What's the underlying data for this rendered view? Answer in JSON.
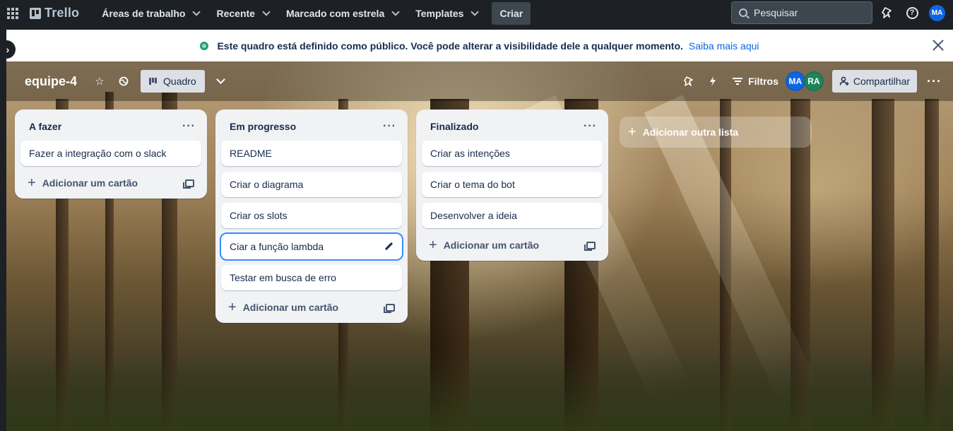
{
  "nav": {
    "logo_text": "Trello",
    "items": [
      {
        "label": "Áreas de trabalho"
      },
      {
        "label": "Recente"
      },
      {
        "label": "Marcado com estrela"
      },
      {
        "label": "Templates"
      }
    ],
    "create_label": "Criar",
    "search_placeholder": "Pesquisar",
    "user_initials": "MA",
    "help_glyph": "?"
  },
  "banner": {
    "text": "Este quadro está definido como público. Você pode alterar a visibilidade dele a qualquer momento.",
    "link": "Saiba mais aqui"
  },
  "board": {
    "title": "equipe-4",
    "view_label": "Quadro",
    "filter_label": "Filtros",
    "members": [
      {
        "initials": "MA",
        "color": "#0c66e4"
      },
      {
        "initials": "RA",
        "color": "#1f845a"
      }
    ],
    "share_label": "Compartilhar",
    "more_glyph": "···"
  },
  "lists": [
    {
      "title": "A fazer",
      "menu_glyph": "···",
      "cards": [
        "Fazer a integração com o slack"
      ],
      "add_card_label": "Adicionar um cartão"
    },
    {
      "title": "Em progresso",
      "menu_glyph": "···",
      "cards": [
        "README",
        "Criar o diagrama",
        "Criar os slots",
        "Ciar a função lambda",
        "Testar em busca de erro"
      ],
      "add_card_label": "Adicionar um cartão"
    },
    {
      "title": "Finalizado",
      "menu_glyph": "···",
      "cards": [
        "Criar as intenções",
        "Criar o tema do bot",
        "Desenvolver a ideia"
      ],
      "add_card_label": "Adicionar um cartão"
    }
  ],
  "add_list_label": "Adicionar outra lista",
  "colors": {
    "nav_bg": "#1d2125",
    "accent": "#0c66e4",
    "focus": "#388bff",
    "public_green": "#22a06b"
  }
}
